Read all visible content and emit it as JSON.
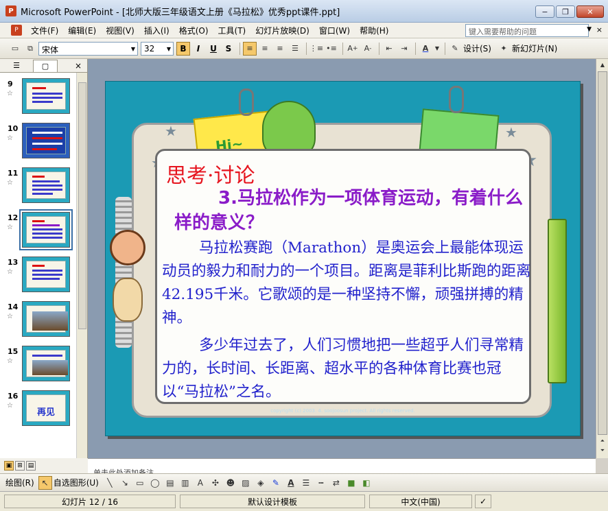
{
  "window": {
    "title": "Microsoft PowerPoint - [北师大版三年级语文上册《马拉松》优秀ppt课件.ppt]",
    "app_icon": "powerpoint-icon",
    "minimize": "−",
    "restore": "❐",
    "close": "✕"
  },
  "menu": {
    "items": [
      "文件(F)",
      "编辑(E)",
      "视图(V)",
      "插入(I)",
      "格式(O)",
      "工具(T)",
      "幻灯片放映(D)",
      "窗口(W)",
      "帮助(H)"
    ],
    "help_placeholder": "键入需要帮助的问题",
    "close": "×"
  },
  "toolbar": {
    "font_name": "宋体",
    "font_size": "32",
    "bold": "B",
    "italic": "I",
    "underline": "U",
    "shadow": "S",
    "design_label": "设计(S)",
    "new_slide_label": "新幻灯片(N)"
  },
  "slides_pane": {
    "close": "×",
    "thumbnails": [
      {
        "num": "9"
      },
      {
        "num": "10"
      },
      {
        "num": "11"
      },
      {
        "num": "12"
      },
      {
        "num": "13"
      },
      {
        "num": "14"
      },
      {
        "num": "15"
      },
      {
        "num": "16",
        "text": "再见"
      }
    ]
  },
  "slide": {
    "heading": "思考·讨论",
    "question": "3.马拉松作为一项体育运动，有着什么样的意义？",
    "para1": "马拉松赛跑（Marathon）是奥运会上最能体现运动员的毅力和耐力的一个项目。距离是菲利比斯跑的距离42.195千米。它歌颂的是一种坚持不懈，顽强拼搏的精神。",
    "para2": "多少年过去了，人们习惯地把一些超乎人们寻常精力的，长时间、长距离、超水平的各种体育比赛也冠以“马拉松”之名。",
    "hi_text": "Hi~",
    "copyright": "copyright (c) 2003. 4. soojoosun project. All rights reserved."
  },
  "notes": {
    "text": "单击此处添加备注"
  },
  "drawing_toolbar": {
    "draw_label": "绘图(R)",
    "autoshapes_label": "自选图形(U)"
  },
  "status": {
    "slide_info": "幻灯片 12 / 16",
    "template": "默认设计模板",
    "language": "中文(中国)"
  }
}
